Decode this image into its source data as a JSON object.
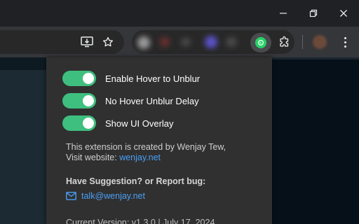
{
  "window": {
    "minimize_icon": "minimize-icon",
    "restore_icon": "restore-icon",
    "close_icon": "close-icon"
  },
  "toolbar": {
    "install_icon": "install-app-icon",
    "bookmark_icon": "star-icon",
    "extension_icon": "whatsapp-icon",
    "extensions_icon": "puzzle-icon",
    "menu_icon": "kebab-menu-icon"
  },
  "popup": {
    "toggles": [
      {
        "label": "Enable Hover to Unblur",
        "on": true
      },
      {
        "label": "No Hover Unblur Delay",
        "on": true
      },
      {
        "label": "Show UI Overlay",
        "on": true
      }
    ],
    "info_line1": "This extension is created by Wenjay Tew,",
    "info_visit": "Visit website:",
    "website_link": "wenjay.net",
    "suggestion_title": "Have Suggestion? or Report bug:",
    "email": "talk@wenjay.net",
    "version": "Current Version: v1.3.0 | July 17, 2024"
  },
  "colors": {
    "toggle_on": "#3fbf7f",
    "link": "#4a9ff5",
    "popup_bg": "#303030",
    "whatsapp": "#25d366"
  }
}
